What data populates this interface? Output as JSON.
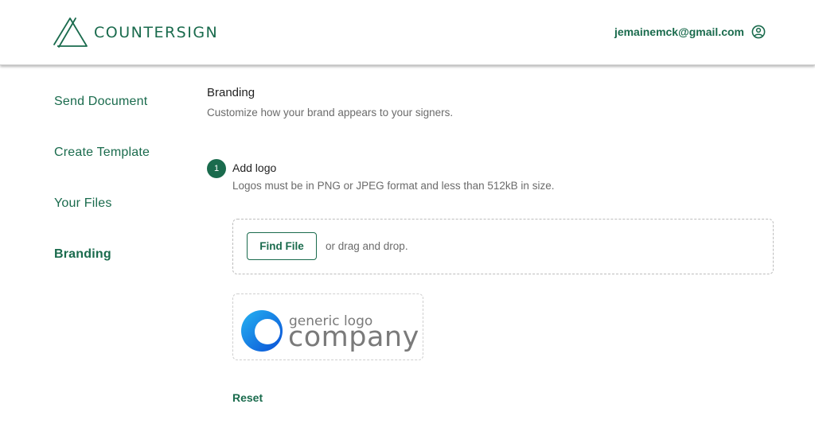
{
  "header": {
    "brand_name": "COUNTERSIGN",
    "account_email": "jemainemck@gmail.com",
    "logo_icon": "countersign-triangle-logo",
    "account_icon": "user-circle-icon"
  },
  "sidebar": {
    "items": [
      {
        "label": "Send Document",
        "active": false
      },
      {
        "label": "Create Template",
        "active": false
      },
      {
        "label": "Your Files",
        "active": false
      },
      {
        "label": "Branding",
        "active": true
      }
    ]
  },
  "main": {
    "title": "Branding",
    "subtitle": "Customize how your brand appears to your signers.",
    "step": {
      "number": "1",
      "title": "Add logo",
      "description": "Logos must be in PNG or JPEG format and less than 512kB in size."
    },
    "dropzone": {
      "button_label": "Find File",
      "hint": "or drag and drop."
    },
    "logo_preview": {
      "line1": "generic logo",
      "line2": "company"
    },
    "reset_label": "Reset"
  },
  "colors": {
    "accent": "#1a6b4d",
    "muted_text": "#6b6b6b",
    "logo_blue": "#1e7be6"
  }
}
